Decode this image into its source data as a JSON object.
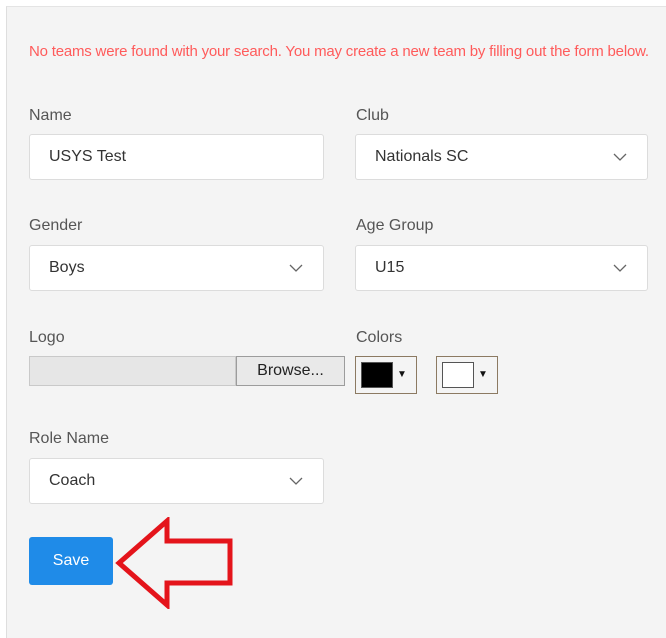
{
  "message": "No teams were found with your search. You may create a new team by filling out the form below.",
  "form": {
    "name": {
      "label": "Name",
      "value": "USYS Test"
    },
    "club": {
      "label": "Club",
      "value": "Nationals SC"
    },
    "gender": {
      "label": "Gender",
      "value": "Boys"
    },
    "age_group": {
      "label": "Age Group",
      "value": "U15"
    },
    "logo": {
      "label": "Logo",
      "browse_label": "Browse..."
    },
    "colors": {
      "label": "Colors",
      "primary": "#000000",
      "secondary": "#ffffff"
    },
    "role_name": {
      "label": "Role Name",
      "value": "Coach"
    },
    "save_label": "Save"
  },
  "theme": {
    "accent": "#1f8be8",
    "error": "#ff5b5b",
    "annotation": "#e4141b"
  }
}
